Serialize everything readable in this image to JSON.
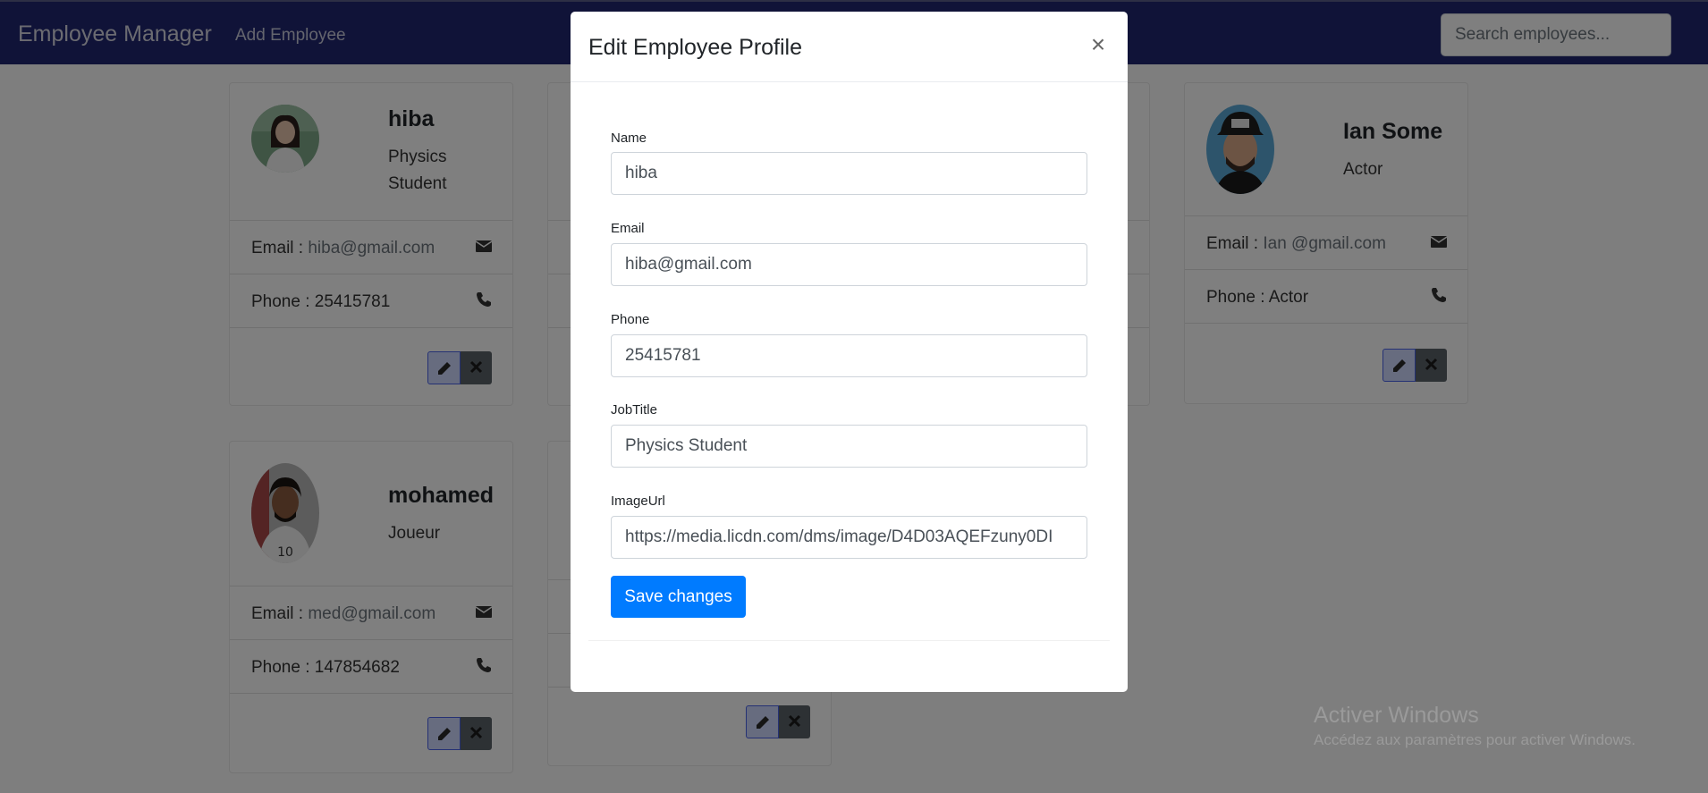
{
  "navbar": {
    "brand": "Employee Manager",
    "add_link": "Add Employee",
    "search_placeholder": "Search employees..."
  },
  "cards": [
    {
      "name": "hiba",
      "job": "Physics Student",
      "email_label": "Email : ",
      "email": "hiba@gmail.com",
      "phone_label": "Phone : ",
      "phone": "25415781"
    },
    {
      "name": "Ian Some",
      "job": "Actor",
      "email_label": "Email : ",
      "email": "Ian @gmail.com",
      "phone_label": "Phone : ",
      "phone": "Actor"
    },
    {
      "name": "mohamed",
      "job": "Joueur",
      "email_label": "Email : ",
      "email": "med@gmail.com",
      "phone_label": "Phone : ",
      "phone": "147854682"
    }
  ],
  "modal": {
    "title": "Edit Employee Profile",
    "close_symbol": "×",
    "fields": [
      {
        "label": "Name",
        "value": "hiba"
      },
      {
        "label": "Email",
        "value": "hiba@gmail.com"
      },
      {
        "label": "Phone",
        "value": "25415781"
      },
      {
        "label": "JobTitle",
        "value": "Physics Student"
      },
      {
        "label": "ImageUrl",
        "value": "https://media.licdn.com/dms/image/D4D03AQEFzuny0DI"
      }
    ],
    "save_label": "Save changes"
  },
  "watermark": {
    "line1": "Activer Windows",
    "line2": "Accédez aux paramètres pour activer Windows."
  },
  "colors": {
    "navbar": "#212670",
    "primary": "#007bff",
    "edit_button": "#cfd8ff",
    "delete_button": "#5a6268"
  },
  "icons": {
    "email": "envelope-icon",
    "phone": "phone-icon",
    "edit": "pencil-icon",
    "delete": "close-icon"
  }
}
